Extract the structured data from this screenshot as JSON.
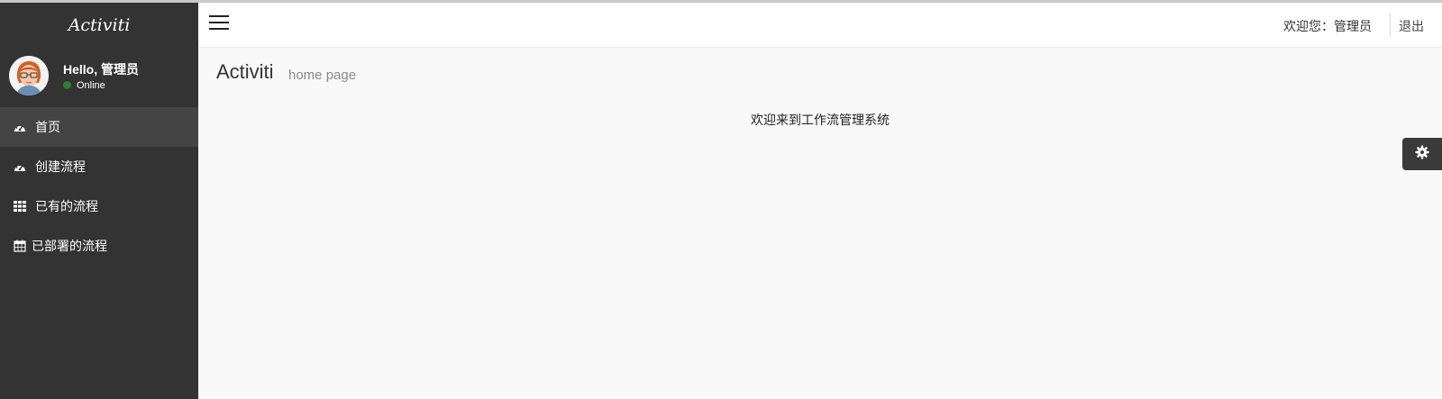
{
  "brand": {
    "title": "Activiti"
  },
  "user": {
    "greeting": "Hello, 管理员",
    "status": "Online"
  },
  "sidebar": {
    "items": [
      {
        "label": "首页",
        "icon": "dashboard-icon",
        "active": true
      },
      {
        "label": "创建流程",
        "icon": "dashboard-icon",
        "active": false
      },
      {
        "label": "已有的流程",
        "icon": "grid-icon",
        "active": false
      },
      {
        "label": "已部署的流程",
        "icon": "calendar-icon",
        "active": false
      }
    ]
  },
  "header": {
    "welcome": "欢迎您：管理员",
    "logout": "退出"
  },
  "page": {
    "title": "Activiti",
    "subtitle": "home page",
    "welcome_message": "欢迎来到工作流管理系统"
  },
  "colors": {
    "sidebar_bg": "#333333",
    "sidebar_active": "#444444",
    "content_bg": "#f9f9f9",
    "online": "#2e7d32"
  }
}
